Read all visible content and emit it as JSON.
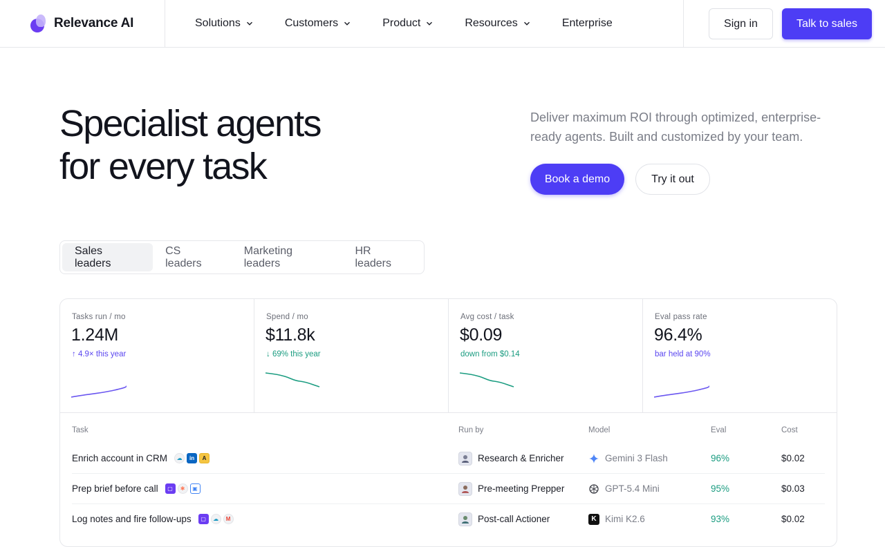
{
  "nav": {
    "brand": "Relevance AI",
    "menu": [
      {
        "label": "Solutions",
        "dropdown": true
      },
      {
        "label": "Customers",
        "dropdown": true
      },
      {
        "label": "Product",
        "dropdown": true
      },
      {
        "label": "Resources",
        "dropdown": true
      },
      {
        "label": "Enterprise",
        "dropdown": false
      }
    ],
    "signin": "Sign in",
    "talk": "Talk to sales"
  },
  "hero": {
    "title_line1": "Specialist agents",
    "title_line2": "for every task",
    "subtitle": "Deliver maximum ROI through optimized, enterprise-ready agents. Built and customized by your team.",
    "primary_cta": "Book a demo",
    "secondary_cta": "Try it out"
  },
  "tabs": [
    "Sales leaders",
    "CS leaders",
    "Marketing leaders",
    "HR leaders"
  ],
  "active_tab": "Sales leaders",
  "stats": [
    {
      "label": "Tasks run / mo",
      "value": "1.24M",
      "note": "↑ 4.9× this year",
      "tone": "purple",
      "trend": "up"
    },
    {
      "label": "Spend / mo",
      "value": "$11.8k",
      "note": "↓ 69% this year",
      "tone": "green",
      "trend": "down"
    },
    {
      "label": "Avg cost / task",
      "value": "$0.09",
      "note": "down from $0.14",
      "tone": "green",
      "trend": "down"
    },
    {
      "label": "Eval pass rate",
      "value": "96.4%",
      "note": "bar held at 90%",
      "tone": "purple",
      "trend": "up"
    }
  ],
  "table": {
    "headers": {
      "task": "Task",
      "run_by": "Run by",
      "model": "Model",
      "eval": "Eval",
      "cost": "Cost"
    },
    "rows": [
      {
        "task": "Enrich account in CRM",
        "apps": [
          "salesforce-icon",
          "linkedin-icon",
          "apollo-icon"
        ],
        "run_by": "Research & Enricher",
        "model": "Gemini 3 Flash",
        "model_icon": "gemini-icon",
        "eval": "96%",
        "cost": "$0.02"
      },
      {
        "task": "Prep brief before call",
        "apps": [
          "calendar-icon",
          "hubspot-icon",
          "google-calendar-icon"
        ],
        "run_by": "Pre-meeting Prepper",
        "model": "GPT-5.4 Mini",
        "model_icon": "openai-icon",
        "eval": "95%",
        "cost": "$0.03"
      },
      {
        "task": "Log notes and fire follow-ups",
        "apps": [
          "calendar-icon",
          "salesforce-icon",
          "gmail-icon"
        ],
        "run_by": "Post-call Actioner",
        "model": "Kimi K2.6",
        "model_icon": "kimi-icon",
        "eval": "93%",
        "cost": "$0.02"
      }
    ]
  },
  "colors": {
    "accent": "#4d3df5",
    "positive": "#1a9c80",
    "spark_purple": "#5b47f0",
    "spark_green": "#1a9c80"
  }
}
